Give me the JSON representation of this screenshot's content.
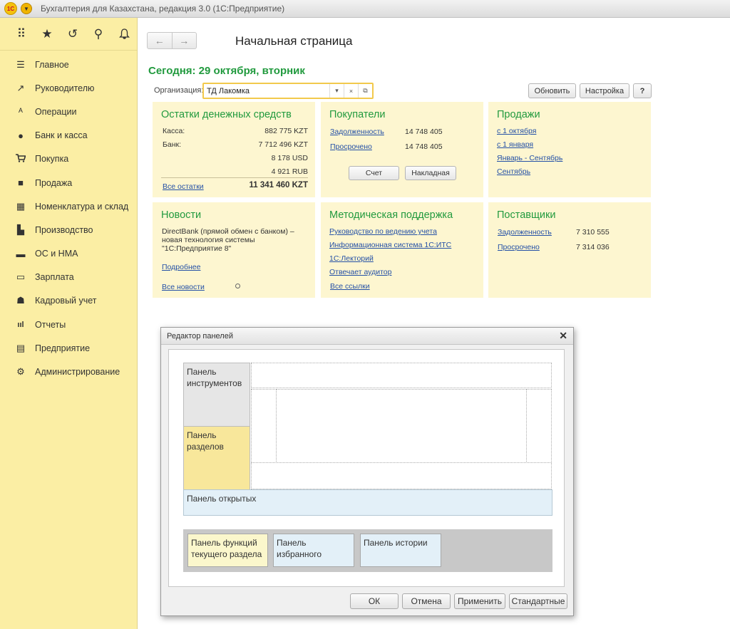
{
  "window": {
    "title": "Бухгалтерия для Казахстана, редакция 3.0  (1С:Предприятие)",
    "logo": "1С"
  },
  "sidebar": {
    "tools": [
      {
        "icon": "apps-grid-icon",
        "glyph": "⠿"
      },
      {
        "icon": "star-icon",
        "glyph": "★"
      },
      {
        "icon": "history-icon",
        "glyph": "↺"
      },
      {
        "icon": "search-icon",
        "glyph": "⚲"
      },
      {
        "icon": "bell-icon",
        "glyph": "🔔"
      }
    ],
    "items": [
      {
        "label": "Главное",
        "icon": "menu-icon",
        "glyph": "☰"
      },
      {
        "label": "Руководителю",
        "icon": "trend-icon",
        "glyph": "↗"
      },
      {
        "label": "Операции",
        "icon": "operations-icon",
        "glyph": "ᴬ"
      },
      {
        "label": "Банк и касса",
        "icon": "bank-icon",
        "glyph": "●"
      },
      {
        "label": "Покупка",
        "icon": "cart-icon",
        "glyph": "🛒"
      },
      {
        "label": "Продажа",
        "icon": "bag-icon",
        "glyph": "■"
      },
      {
        "label": "Номенклатура и склад",
        "icon": "warehouse-icon",
        "glyph": "▦"
      },
      {
        "label": "Производство",
        "icon": "factory-icon",
        "glyph": "▙"
      },
      {
        "label": "ОС и НМА",
        "icon": "truck-icon",
        "glyph": "▬"
      },
      {
        "label": "Зарплата",
        "icon": "wallet-icon",
        "glyph": "▭"
      },
      {
        "label": "Кадровый учет",
        "icon": "people-icon",
        "glyph": "☗"
      },
      {
        "label": "Отчеты",
        "icon": "bar-chart-icon",
        "glyph": "ııl"
      },
      {
        "label": "Предприятие",
        "icon": "building-icon",
        "glyph": "▤"
      },
      {
        "label": "Администрирование",
        "icon": "gear-icon",
        "glyph": "⚙"
      }
    ]
  },
  "main": {
    "page_title": "Начальная страница",
    "today": "Сегодня: 29 октября, вторник",
    "org_label": "Организация:",
    "org_value": "ТД Лакомка",
    "refresh": "Обновить",
    "settings": "Настройка",
    "help": "?"
  },
  "panels": {
    "cash": {
      "title": "Остатки денежных средств",
      "kassa_label": "Касса:",
      "kassa_value": "882 775 KZT",
      "bank_label": "Банк:",
      "bank_value": "7 712 496 KZT",
      "usd": "8 178 USD",
      "rub": "4 921 RUB",
      "all_link": "Все остатки",
      "total": "11 341 460 KZT"
    },
    "buyers": {
      "title": "Покупатели",
      "debt_link": "Задолженность",
      "debt_value": "14 748 405",
      "overdue_link": "Просрочено",
      "overdue_value": "14 748 405",
      "invoice_btn": "Счет",
      "waybill_btn": "Накладная"
    },
    "sales": {
      "title": "Продажи",
      "links": [
        "с 1 октября",
        "с 1 января",
        "Январь - Сентябрь",
        "Сентябрь"
      ]
    },
    "news": {
      "title": "Новости",
      "text1": "DirectBank (прямой обмен с банком) –",
      "text2": "новая технология системы",
      "text3": "\"1С:Предприятие 8\"",
      "more": "Подробнее",
      "all": "Все новости"
    },
    "support": {
      "title": "Методическая поддержка",
      "links": [
        "Руководство по ведению учета",
        "Информационная система 1С:ИТС",
        "1С:Лекторий",
        "Отвечает аудитор",
        "Все ссылки"
      ]
    },
    "suppliers": {
      "title": "Поставщики",
      "debt_link": "Задолженность",
      "debt_value": "7 310 555",
      "overdue_link": "Просрочено",
      "overdue_value": "7 314 036"
    }
  },
  "dialog": {
    "title": "Редактор панелей",
    "tools_panel": "Панель инструментов",
    "sections_panel": "Панель разделов",
    "open_panel": "Панель открытых",
    "functions_panel": "Панель функций текущего раздела",
    "favorites_panel": "Панель избранного",
    "history_panel": "Панель истории",
    "ok": "ОК",
    "cancel": "Отмена",
    "apply": "Применить",
    "standard": "Стандартные"
  }
}
